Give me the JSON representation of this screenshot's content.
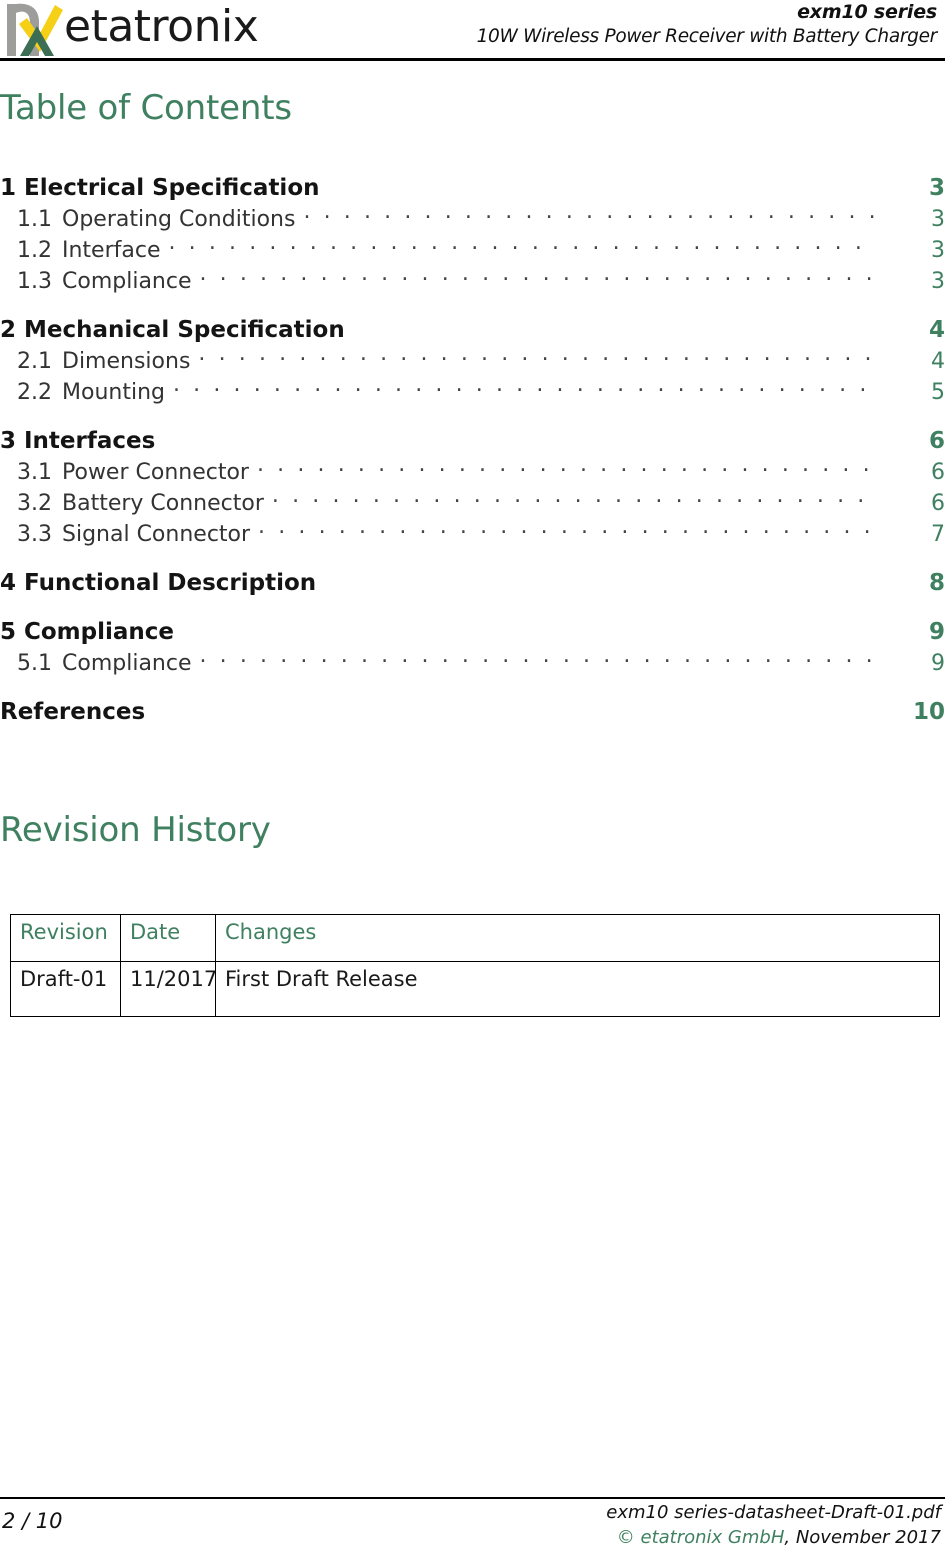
{
  "header": {
    "logo_icon": "etatronix-logo-icon",
    "wordmark": "etatronix",
    "title": "exm10 series",
    "subtitle": "10W Wireless Power Receiver with Battery Charger"
  },
  "toc": {
    "heading": "Table of Contents",
    "groups": [
      {
        "main": {
          "number": "1",
          "label": "Electrical Specification",
          "page": "3"
        },
        "subs": [
          {
            "number": "1.1",
            "label": "Operating Conditions",
            "page": "3"
          },
          {
            "number": "1.2",
            "label": "Interface",
            "page": "3"
          },
          {
            "number": "1.3",
            "label": "Compliance",
            "page": "3"
          }
        ]
      },
      {
        "main": {
          "number": "2",
          "label": "Mechanical Specification",
          "page": "4"
        },
        "subs": [
          {
            "number": "2.1",
            "label": "Dimensions",
            "page": "4"
          },
          {
            "number": "2.2",
            "label": "Mounting",
            "page": "5"
          }
        ]
      },
      {
        "main": {
          "number": "3",
          "label": "Interfaces",
          "page": "6"
        },
        "subs": [
          {
            "number": "3.1",
            "label": "Power Connector",
            "page": "6"
          },
          {
            "number": "3.2",
            "label": "Battery Connector",
            "page": "6"
          },
          {
            "number": "3.3",
            "label": "Signal Connector",
            "page": "7"
          }
        ]
      },
      {
        "main": {
          "number": "4",
          "label": "Functional Description",
          "page": "8"
        },
        "subs": []
      },
      {
        "main": {
          "number": "5",
          "label": "Compliance",
          "page": "9"
        },
        "subs": [
          {
            "number": "5.1",
            "label": "Compliance",
            "page": "9"
          }
        ]
      },
      {
        "main": {
          "number": "",
          "label": "References",
          "page": "10"
        },
        "subs": []
      }
    ]
  },
  "revision": {
    "heading": "Revision History",
    "columns": [
      "Revision",
      "Date",
      "Changes"
    ],
    "rows": [
      [
        "Draft-01",
        "11/2017",
        "First Draft Release"
      ]
    ]
  },
  "footer": {
    "page_label": "2 / 10",
    "file_name": "exm10 series-datasheet-Draft-01.pdf",
    "copyright_green": "© etatronix GmbH",
    "copyright_rest": ", November 2017"
  },
  "colors": {
    "accent_green": "#3f8060",
    "logo_gray": "#9d9d9c",
    "logo_yellow": "#f5d016",
    "logo_darkgreen": "#3c6e55",
    "text": "#1a1a1a"
  }
}
